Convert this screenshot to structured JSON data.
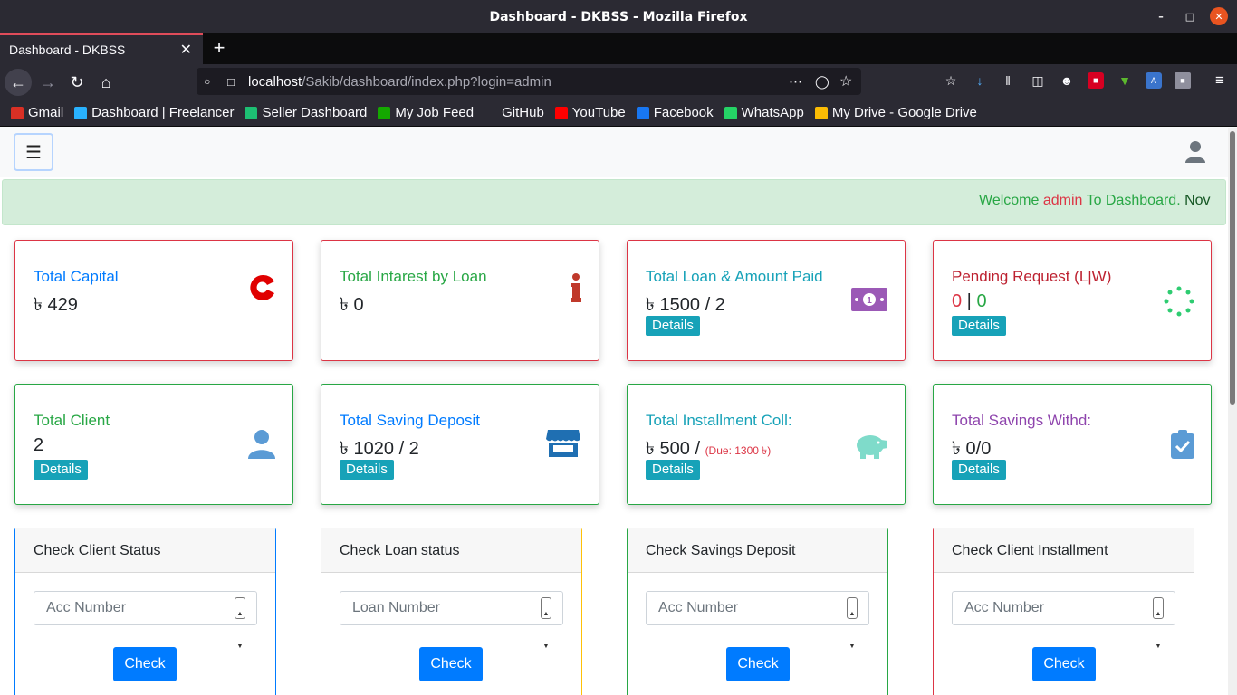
{
  "window": {
    "title": "Dashboard - DKBSS - Mozilla Firefox"
  },
  "tab": {
    "label": "Dashboard - DKBSS"
  },
  "url": {
    "host": "localhost",
    "path": "/Sakib/dashboard/index.php?login=admin"
  },
  "bookmarks": [
    {
      "label": "Gmail",
      "icon": "gmail-icon",
      "color": "#d93025"
    },
    {
      "label": "Dashboard | Freelancer",
      "icon": "freelancer-icon",
      "color": "#29b2fe"
    },
    {
      "label": "Seller Dashboard",
      "icon": "fiverr-icon",
      "color": "#1dbf73"
    },
    {
      "label": "My Job Feed",
      "icon": "upwork-icon",
      "color": "#14a800"
    },
    {
      "label": "GitHub",
      "icon": "github-icon",
      "color": "#2b2a33"
    },
    {
      "label": "YouTube",
      "icon": "youtube-icon",
      "color": "#ff0000"
    },
    {
      "label": "Facebook",
      "icon": "facebook-icon",
      "color": "#1877f2"
    },
    {
      "label": "WhatsApp",
      "icon": "whatsapp-icon",
      "color": "#25d366"
    },
    {
      "label": "My Drive - Google Drive",
      "icon": "google-drive-icon",
      "color": "#fbbc04"
    }
  ],
  "welcome": {
    "prefix": "Welcome",
    "user": "admin",
    "suffix": "To Dashboard.",
    "tail": "Nov"
  },
  "cards": {
    "capital": {
      "title": "Total Capital",
      "value": "৳ 429",
      "icon": "c-logo-icon",
      "color": "#007bff"
    },
    "interest": {
      "title": "Total Intarest by Loan",
      "value": "৳ 0",
      "icon": "info-icon",
      "color": "#28a745"
    },
    "loan": {
      "title": "Total Loan & Amount Paid",
      "value": "৳ 1500 / 2",
      "details": "Details",
      "icon": "money-bill-icon",
      "color": "#17a2b8"
    },
    "pending": {
      "title": "Pending Request (L|W)",
      "value_l": "0",
      "sep": " | ",
      "value_w": "0",
      "details": "Details",
      "icon": "spinner-icon",
      "color": "#bd2130"
    },
    "client": {
      "title": "Total Client",
      "value": "2",
      "details": "Details",
      "icon": "user-icon",
      "color": "#28a745"
    },
    "saving": {
      "title": "Total Saving Deposit",
      "value": "৳ 1020 / 2",
      "details": "Details",
      "icon": "store-icon",
      "color": "#007bff"
    },
    "installment": {
      "title": "Total Installment Coll:",
      "value": "৳ 500 / ",
      "due": "(Due: 1300 ৳)",
      "details": "Details",
      "icon": "piggy-bank-icon",
      "color": "#17a2b8"
    },
    "withdraw": {
      "title": "Total Savings Withd:",
      "value": "৳ 0/0",
      "details": "Details",
      "icon": "clipboard-check-icon",
      "color": "#6f42c1"
    }
  },
  "forms": [
    {
      "title": "Check Client Status",
      "placeholder": "Acc Number",
      "button": "Check"
    },
    {
      "title": "Check Loan status",
      "placeholder": "Loan Number",
      "button": "Check"
    },
    {
      "title": "Check Savings Deposit",
      "placeholder": "Acc Number",
      "button": "Check"
    },
    {
      "title": "Check Client Installment",
      "placeholder": "Acc Number",
      "button": "Check"
    }
  ]
}
